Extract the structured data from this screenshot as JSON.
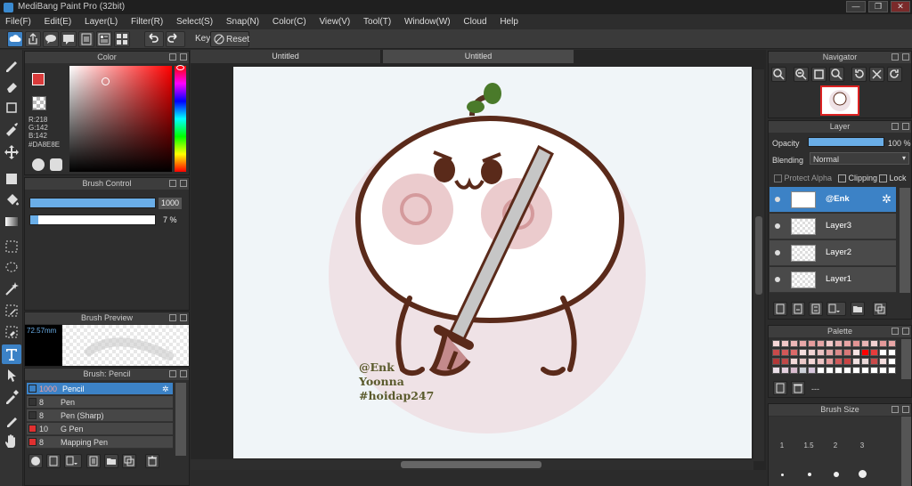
{
  "window": {
    "title": "MediBang Paint Pro (32bit)",
    "minimize": "—",
    "restore": "❐",
    "close": "✕"
  },
  "menu": [
    "File(F)",
    "Edit(E)",
    "Layer(L)",
    "Filter(R)",
    "Select(S)",
    "Snap(N)",
    "Color(C)",
    "View(V)",
    "Tool(T)",
    "Window(W)",
    "Cloud",
    "Help"
  ],
  "toolbar": {
    "key_label": "Key",
    "reset_label": "Reset"
  },
  "color_panel": {
    "title": "Color",
    "r": "R:218",
    "g": "G:142",
    "b": "B:142",
    "hex": "#DA8E8E",
    "fg_color": "#da3b3b"
  },
  "brush_control": {
    "title": "Brush Control",
    "size_value": "1000",
    "opacity_value": "7 %"
  },
  "brush_preview": {
    "title": "Brush Preview",
    "size_label": "72.57mm"
  },
  "brush_list": {
    "title": "Brush: Pencil",
    "items": [
      {
        "size": "1000",
        "name": "Pencil",
        "color": "#3c82c6"
      },
      {
        "size": "8",
        "name": "Pen",
        "color": "#333333"
      },
      {
        "size": "8",
        "name": "Pen (Sharp)",
        "color": "#333333"
      },
      {
        "size": "10",
        "name": "G Pen",
        "color": "#e03030"
      },
      {
        "size": "8",
        "name": "Mapping Pen",
        "color": "#e03030"
      }
    ]
  },
  "tabs": [
    "Untitled",
    "Untitled"
  ],
  "canvas": {
    "sig_line1": "@Enk",
    "sig_line2": "Yoonna",
    "sig_line3": "#hoidap247"
  },
  "navigator": {
    "title": "Navigator"
  },
  "layer_panel": {
    "title": "Layer",
    "opacity_label": "Opacity",
    "opacity_value": "100 %",
    "blending_label": "Blending",
    "blending_value": "Normal",
    "protect_alpha": "Protect Alpha",
    "clipping": "Clipping",
    "lock": "Lock",
    "layers": [
      "@Enk",
      "Layer3",
      "Layer2",
      "Layer1"
    ]
  },
  "palette": {
    "title": "Palette",
    "add_label": "---",
    "colors": [
      "#f5d7d7",
      "#f0c8c8",
      "#ecb8b8",
      "#e8a8a8",
      "#e59c9c",
      "#e5a5a5",
      "#f2c9c9",
      "#e8b0b0",
      "#e8a4a4",
      "#e29494",
      "#e8b4b4",
      "#f0d0d0",
      "#e49a9a",
      "#e8a6a6",
      "#c94a4a",
      "#d35858",
      "#dc6a6a",
      "#f4dede",
      "#f0d3d3",
      "#eac2c2",
      "#e4a6a6",
      "#dc8a8a",
      "#d97878",
      "#f6e4e4",
      "#ff0000",
      "#e83c3c",
      "#ffffff",
      "#ffffff",
      "#b23838",
      "#c04848",
      "#f3dada",
      "#eac8c8",
      "#f3d6d6",
      "#ecc3c3",
      "#e69c9c",
      "#d05a5a",
      "#c94444",
      "#f0e0e0",
      "#e8d6d6",
      "#c94a4a",
      "#f4dede",
      "#ffffff",
      "#eadfe8",
      "#e4d0de",
      "#d9bccf",
      "#ccd0d8",
      "#d6c6dc",
      "#ffffff",
      "#ffffff",
      "#ffffff",
      "#ffffff",
      "#ffffff",
      "#ffffff",
      "#ffffff",
      "#ffffff",
      "#ffffff"
    ]
  },
  "brush_size": {
    "title": "Brush Size",
    "sizes": [
      "1",
      "1.5",
      "2",
      "3"
    ]
  }
}
